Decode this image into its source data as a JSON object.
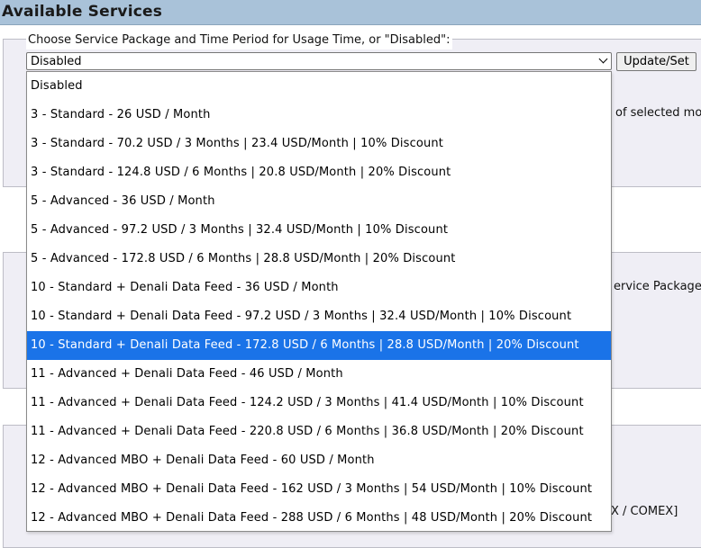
{
  "header": {
    "title": "Available Services"
  },
  "fieldset": {
    "legend": "Choose Service Package and Time Period for Usage Time, or \"Disabled\":",
    "select_value": "Disabled",
    "button_label": "Update/Set"
  },
  "background_text": {
    "p1_right": "of selected mo",
    "p2_right": "ervice Package",
    "p3_right": "X / COMEX]"
  },
  "dropdown": {
    "selected_index": 9,
    "options": [
      "Disabled",
      "3 - Standard - 26 USD / Month",
      "3 - Standard - 70.2 USD / 3 Months | 23.4 USD/Month | 10% Discount",
      "3 - Standard - 124.8 USD / 6 Months | 20.8 USD/Month | 20% Discount",
      "5 - Advanced - 36 USD / Month",
      "5 - Advanced - 97.2 USD / 3 Months | 32.4 USD/Month | 10% Discount",
      "5 - Advanced - 172.8 USD / 6 Months | 28.8 USD/Month | 20% Discount",
      "10 - Standard + Denali Data Feed - 36 USD / Month",
      "10 - Standard + Denali Data Feed - 97.2 USD / 3 Months | 32.4 USD/Month | 10% Discount",
      "10 - Standard + Denali Data Feed - 172.8 USD / 6 Months | 28.8 USD/Month | 20% Discount",
      "11 - Advanced + Denali Data Feed - 46 USD / Month",
      "11 - Advanced + Denali Data Feed - 124.2 USD / 3 Months | 41.4 USD/Month | 10% Discount",
      "11 - Advanced + Denali Data Feed - 220.8 USD / 6 Months | 36.8 USD/Month | 20% Discount",
      "12 - Advanced MBO + Denali Data Feed - 60 USD / Month",
      "12 - Advanced MBO + Denali Data Feed - 162 USD / 3 Months | 54 USD/Month | 10% Discount",
      "12 - Advanced MBO + Denali Data Feed - 288 USD / 6 Months | 48 USD/Month | 20% Discount"
    ]
  },
  "colors": {
    "header_bg": "#a9c2d9",
    "panel_bg": "#efeef5",
    "selected_bg": "#1a73e8"
  }
}
